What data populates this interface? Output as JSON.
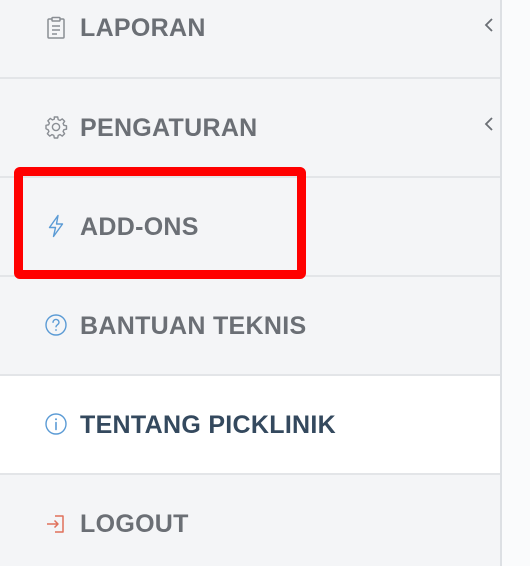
{
  "sidebar": {
    "items": [
      {
        "label": "LAPORAN",
        "icon": "report-icon",
        "has_submenu": true
      },
      {
        "label": "PENGATURAN",
        "icon": "gear-icon",
        "has_submenu": true
      },
      {
        "label": "ADD-ONS",
        "icon": "lightning-icon",
        "has_submenu": false
      },
      {
        "label": "BANTUAN TEKNIS",
        "icon": "help-circle-icon",
        "has_submenu": false
      },
      {
        "label": "TENTANG PICKLINIK",
        "icon": "info-circle-icon",
        "has_submenu": false,
        "active": true
      },
      {
        "label": "LOGOUT",
        "icon": "logout-icon",
        "has_submenu": false
      }
    ]
  },
  "annotation": {
    "highlight_color": "#ff0000",
    "highlighted_item": "ADD-ONS"
  },
  "colors": {
    "label_default": "#6b6f75",
    "label_active": "#34495e",
    "icon_accent": "#5b9bd5",
    "logout_icon": "#e0705a",
    "sidebar_bg": "#f4f5f7"
  }
}
